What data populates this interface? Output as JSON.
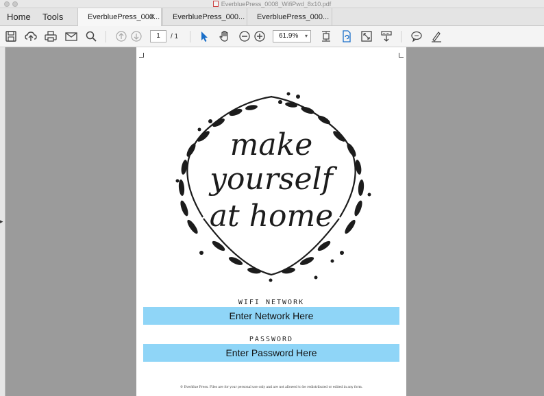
{
  "window": {
    "title": "EverbluePress_0008_WifiPwd_8x10.pdf"
  },
  "nav": {
    "home": "Home",
    "tools": "Tools"
  },
  "tabs": [
    {
      "label": "EverbluePress_000...",
      "active": true,
      "closable": true
    },
    {
      "label": "EverbluePress_000...",
      "active": false
    },
    {
      "label": "EverbluePress_000...",
      "active": false
    }
  ],
  "toolbar": {
    "icons": [
      "save-icon",
      "upload-cloud-icon",
      "print-icon",
      "email-icon",
      "search-icon",
      "previous-page-icon",
      "next-page-icon",
      "select-arrow-icon",
      "hand-icon",
      "zoom-out-icon",
      "zoom-in-icon",
      "fit-page-icon",
      "rotate-icon",
      "full-screen-icon",
      "scroll-mode-icon",
      "comment-icon",
      "sign-icon"
    ],
    "page_current": "1",
    "page_total": "/ 1",
    "zoom": "61.9%"
  },
  "document": {
    "phrase_line1": "make",
    "phrase_line2": "yourself",
    "phrase_line3": "at home",
    "wifi_label": "WIFI NETWORK",
    "wifi_value": "Enter Network Here",
    "password_label": "PASSWORD",
    "password_value": "Enter Password Here",
    "footer": "© Everblue Press. Files are for your personal use only and are not allowed to be redistributed or edited in any form."
  },
  "colors": {
    "field_bg": "#8fd5f7",
    "canvas_bg": "#9b9b9b",
    "accent_blue": "#1a6fc9"
  }
}
